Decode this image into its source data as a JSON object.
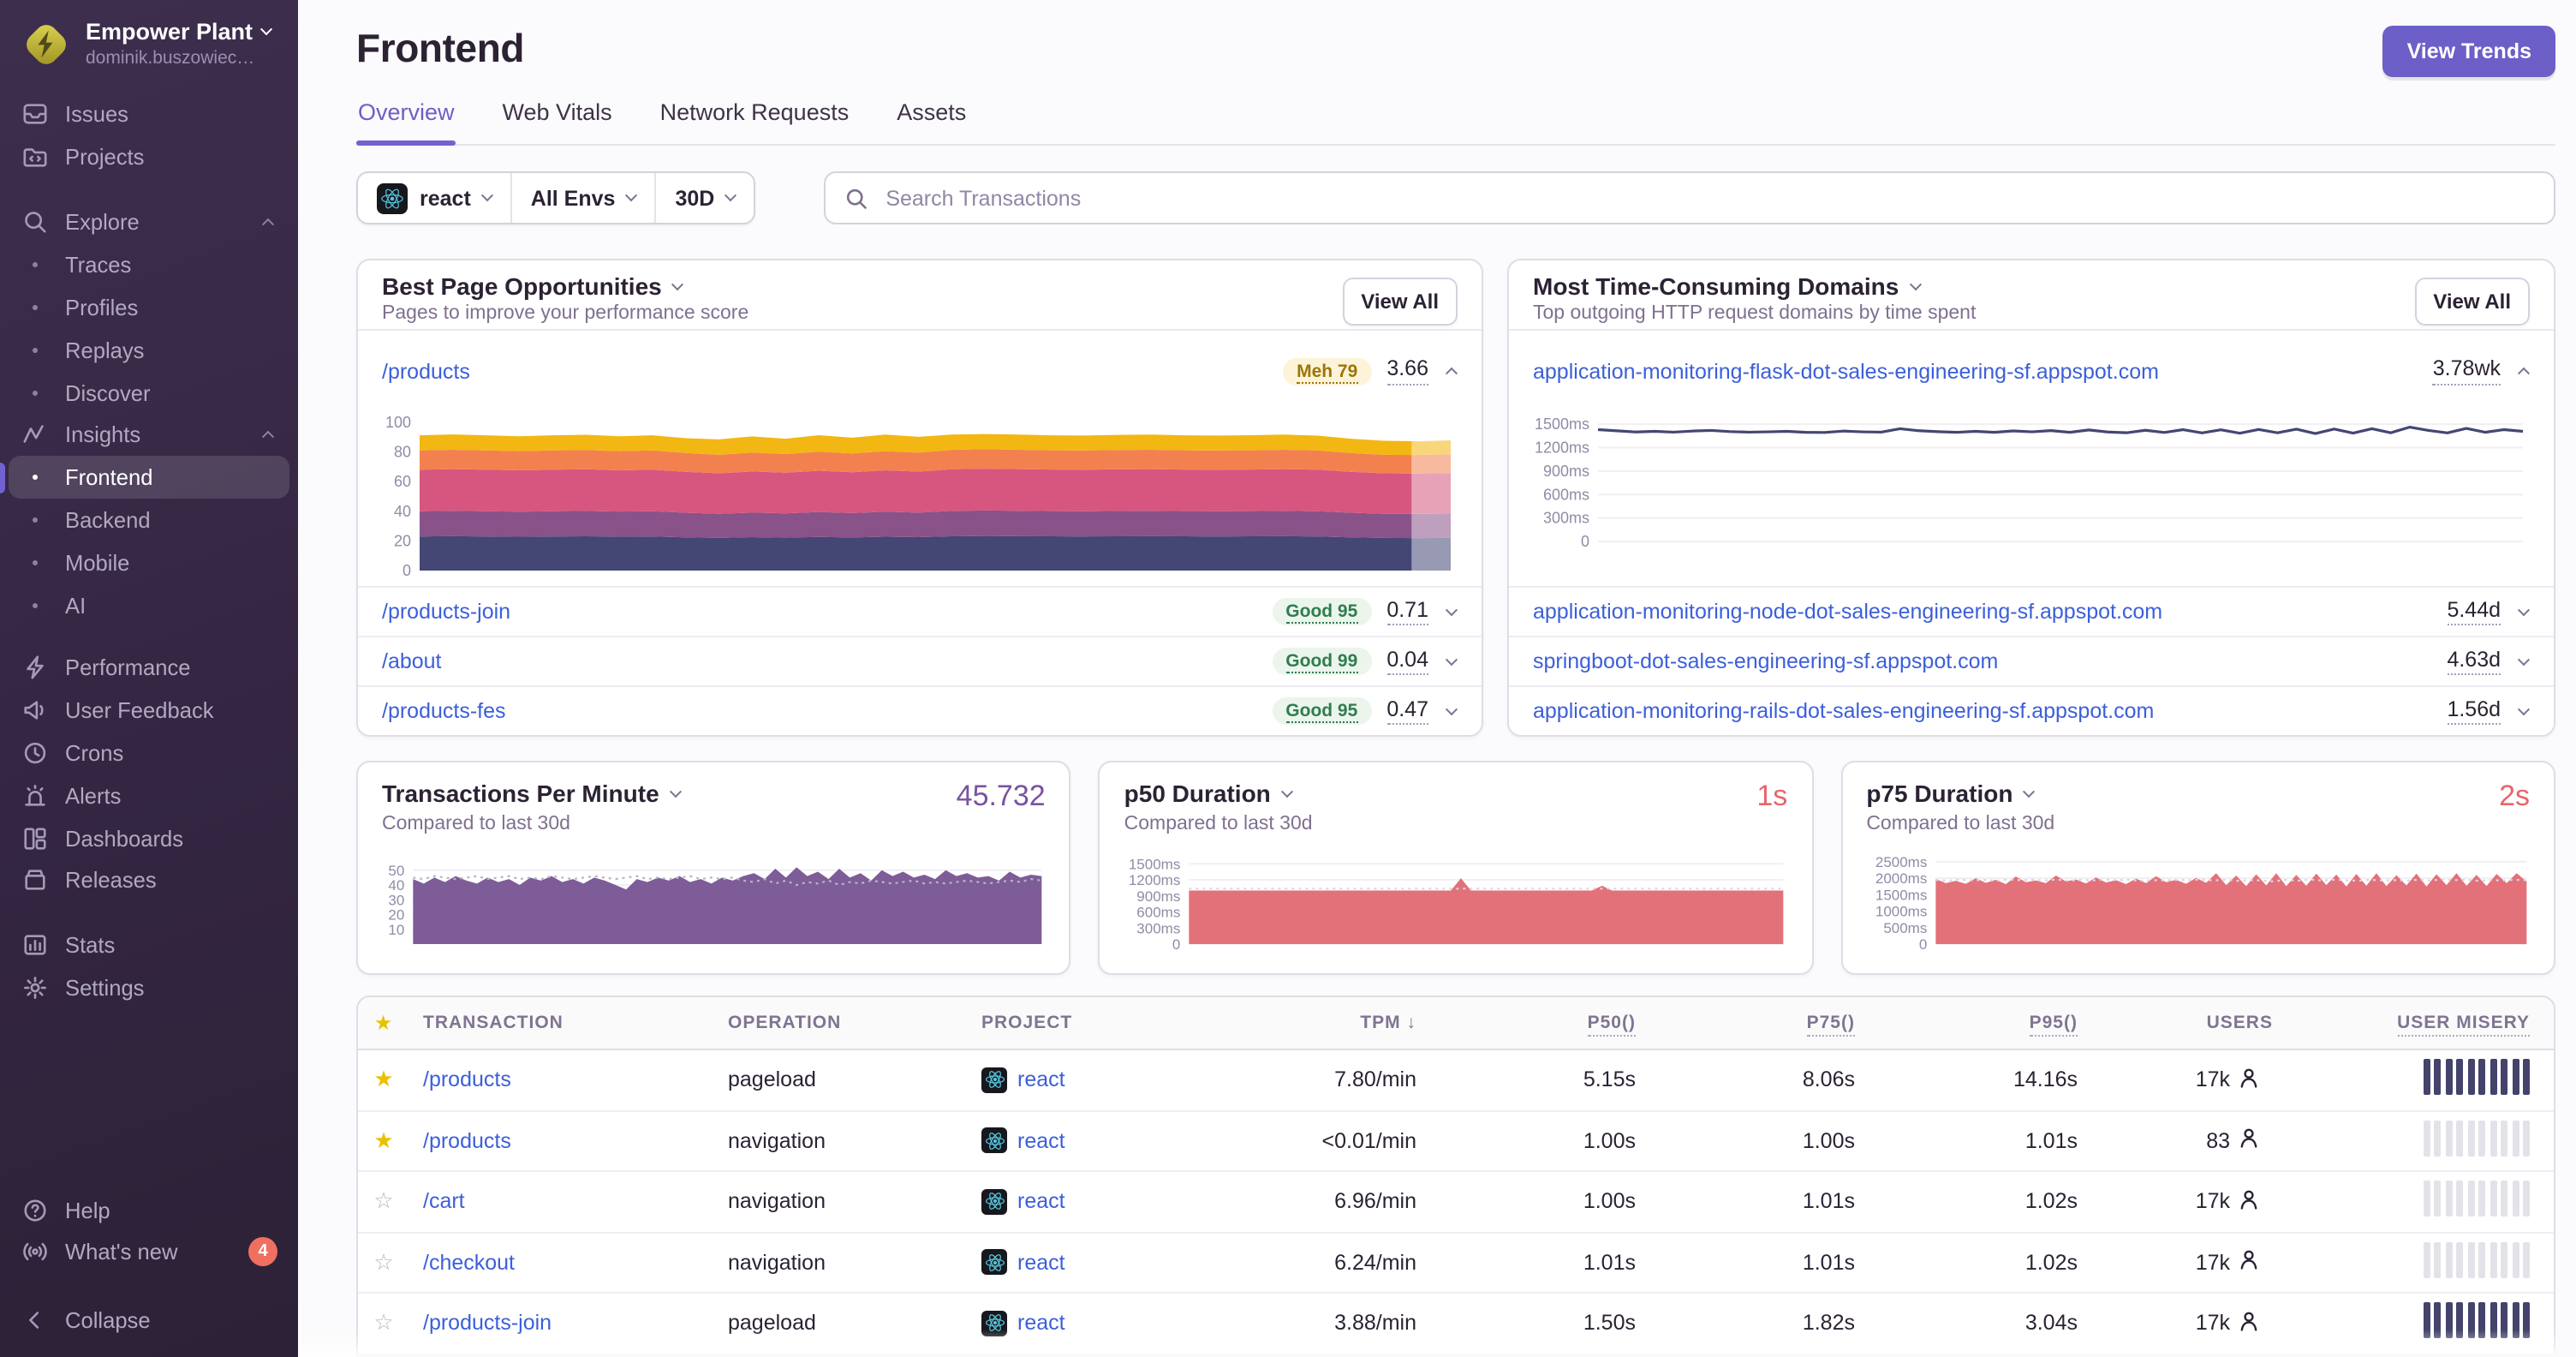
{
  "colors": {
    "accent": "#6C5FC7",
    "link": "#3c5fd9",
    "value_purple": "#7a52a0",
    "value_red": "#e7656d",
    "misery_high": "#43436b",
    "misery_low": "#e4e2e9",
    "badge_meh_bg": "#fdf3d8",
    "badge_meh_text": "#9c7507",
    "badge_good_bg": "#ebf5ec",
    "badge_good_text": "#2f7d4f",
    "whats_new_badge": "#ef7061",
    "sidebar_accent": "#7262d1"
  },
  "sidebar": {
    "org_name": "Empower Plant",
    "org_user": "dominik.buszowiec…",
    "sections": [
      {
        "gap": "",
        "items": [
          {
            "label": "Issues",
            "icon": "issues-icon"
          },
          {
            "label": "Projects",
            "icon": "projects-icon"
          }
        ]
      },
      {
        "gap": "sec-gap1",
        "items": [
          {
            "label": "Explore",
            "icon": "search-icon",
            "chevron": "up"
          },
          {
            "label": "Traces",
            "bullet": true
          },
          {
            "label": "Profiles",
            "bullet": true
          },
          {
            "label": "Replays",
            "bullet": true
          },
          {
            "label": "Discover",
            "bullet": true
          },
          {
            "label": "Insights",
            "icon": "insights-icon",
            "chevron": "up"
          },
          {
            "label": "Frontend",
            "bullet": true,
            "active": true
          },
          {
            "label": "Backend",
            "bullet": true
          },
          {
            "label": "Mobile",
            "bullet": true
          },
          {
            "label": "AI",
            "bullet": true
          }
        ]
      },
      {
        "gap": "sec-gap2",
        "items": [
          {
            "label": "Performance",
            "icon": "performance-icon"
          },
          {
            "label": "User Feedback",
            "icon": "megaphone-icon"
          },
          {
            "label": "Crons",
            "icon": "clock-icon"
          },
          {
            "label": "Alerts",
            "icon": "siren-icon"
          },
          {
            "label": "Dashboards",
            "icon": "dashboards-icon"
          },
          {
            "label": "Releases",
            "icon": "releases-icon"
          }
        ]
      },
      {
        "gap": "sec-gap3",
        "items": [
          {
            "label": "Stats",
            "icon": "stats-icon"
          },
          {
            "label": "Settings",
            "icon": "gear-icon"
          }
        ]
      }
    ],
    "footer": [
      {
        "label": "Help",
        "icon": "help-icon"
      },
      {
        "label": "What's new",
        "icon": "broadcast-icon",
        "badge": "4"
      },
      {
        "label": "Collapse",
        "icon": "chevron-left-icon",
        "gap": true
      }
    ]
  },
  "header": {
    "title": "Frontend",
    "view_trends_label": "View Trends",
    "tabs": [
      {
        "label": "Overview",
        "active": true
      },
      {
        "label": "Web Vitals"
      },
      {
        "label": "Network Requests"
      },
      {
        "label": "Assets"
      }
    ]
  },
  "filters": {
    "project": "react",
    "environment": "All Envs",
    "date_range": "30D",
    "search_placeholder": "Search Transactions"
  },
  "best_pages": {
    "title": "Best Page Opportunities",
    "subtitle": "Pages to improve your performance score",
    "view_all_label": "View All",
    "expanded_row": {
      "page": "/products",
      "badge_label": "Meh 79",
      "badge_type": "meh",
      "score": "3.66"
    },
    "rows": [
      {
        "page": "/products-join",
        "badge_label": "Good 95",
        "badge_type": "good",
        "score": "0.71"
      },
      {
        "page": "/about",
        "badge_label": "Good 99",
        "badge_type": "good",
        "score": "0.04"
      },
      {
        "page": "/products-fes",
        "badge_label": "Good 95",
        "badge_type": "good",
        "score": "0.47"
      }
    ]
  },
  "domains": {
    "title": "Most Time-Consuming Domains",
    "subtitle": "Top outgoing HTTP request domains by time spent",
    "view_all_label": "View All",
    "expanded_row": {
      "domain": "application-monitoring-flask-dot-sales-engineering-sf.appspot.com",
      "value": "3.78wk"
    },
    "rows": [
      {
        "domain": "application-monitoring-node-dot-sales-engineering-sf.appspot.com",
        "value": "5.44d"
      },
      {
        "domain": "springboot-dot-sales-engineering-sf.appspot.com",
        "value": "4.63d"
      },
      {
        "domain": "application-monitoring-rails-dot-sales-engineering-sf.appspot.com",
        "value": "1.56d"
      }
    ]
  },
  "metrics": [
    {
      "id": "tpm",
      "title": "Transactions Per Minute",
      "subtitle": "Compared to last 30d",
      "value": "45.732",
      "value_color": "#7a52a0"
    },
    {
      "id": "p50",
      "title": "p50 Duration",
      "subtitle": "Compared to last 30d",
      "value": "1s",
      "value_color": "#e7656d"
    },
    {
      "id": "p75",
      "title": "p75 Duration",
      "subtitle": "Compared to last 30d",
      "value": "2s",
      "value_color": "#e7656d"
    }
  ],
  "table": {
    "sorted_column": "TPM",
    "sort_direction": "desc",
    "sort_arrow": "↓",
    "columns": [
      "TRANSACTION",
      "OPERATION",
      "PROJECT",
      "TPM",
      "P50()",
      "P75()",
      "P95()",
      "USERS",
      "USER MISERY"
    ],
    "rows": [
      {
        "starred": true,
        "transaction": "/products",
        "operation": "pageload",
        "project": "react",
        "tpm": "7.80/min",
        "p50": "5.15s",
        "p75": "8.06s",
        "p95": "14.16s",
        "users": "17k",
        "misery": "high"
      },
      {
        "starred": true,
        "transaction": "/products",
        "operation": "navigation",
        "project": "react",
        "tpm": "<0.01/min",
        "p50": "1.00s",
        "p75": "1.00s",
        "p95": "1.01s",
        "users": "83",
        "misery": "low"
      },
      {
        "starred": false,
        "transaction": "/cart",
        "operation": "navigation",
        "project": "react",
        "tpm": "6.96/min",
        "p50": "1.00s",
        "p75": "1.01s",
        "p95": "1.02s",
        "users": "17k",
        "misery": "low"
      },
      {
        "starred": false,
        "transaction": "/checkout",
        "operation": "navigation",
        "project": "react",
        "tpm": "6.24/min",
        "p50": "1.01s",
        "p75": "1.01s",
        "p95": "1.02s",
        "users": "17k",
        "misery": "low"
      },
      {
        "starred": false,
        "transaction": "/products-join",
        "operation": "pageload",
        "project": "react",
        "tpm": "3.88/min",
        "p50": "1.50s",
        "p75": "1.82s",
        "p95": "3.04s",
        "users": "17k",
        "misery": "high"
      }
    ]
  },
  "chart_data": [
    {
      "id": "page_score_breakdown",
      "type": "stacked_area",
      "title": "/products performance score breakdown",
      "grid": false,
      "ylim": [
        0,
        104
      ],
      "label_width": 30,
      "tick_font": 9,
      "incomplete_from": 0.962,
      "yticks": [
        [
          100,
          "100"
        ],
        [
          80,
          "80"
        ],
        [
          60,
          "60"
        ],
        [
          40,
          "40"
        ],
        [
          20,
          "20"
        ],
        [
          0,
          "0"
        ]
      ],
      "series": [
        {
          "name": "layer-1",
          "color": "#444674",
          "values": [
            23,
            23.2,
            23,
            22.8,
            23,
            23.1,
            22.9,
            23,
            22.4,
            22,
            22.5,
            22.2,
            22.7,
            22.3,
            22.8,
            22.5,
            23.1,
            23.3,
            23.2,
            23.1,
            23,
            23.1,
            23.2,
            23.1,
            23,
            23.1,
            23.2,
            23,
            22.4,
            22,
            21.9,
            22
          ]
        },
        {
          "name": "layer-2",
          "color": "#895289",
          "values": [
            17,
            17.1,
            17,
            16.9,
            17,
            17.1,
            16.9,
            17,
            16.6,
            16.3,
            16.6,
            16.4,
            16.8,
            16.5,
            16.9,
            16.6,
            17.1,
            17.2,
            17.1,
            17,
            17,
            17.1,
            17.1,
            17,
            17,
            17,
            17.1,
            17,
            16.6,
            16.3,
            16.3,
            16.4
          ]
        },
        {
          "name": "layer-3",
          "color": "#d6567f",
          "values": [
            28,
            28.1,
            28,
            27.9,
            28,
            28.1,
            27.8,
            28,
            27.6,
            27.3,
            27.7,
            27.4,
            27.8,
            27.5,
            27.9,
            27.6,
            28.1,
            28.2,
            28.1,
            28,
            28,
            28.1,
            28.1,
            28,
            28,
            28,
            28.1,
            28,
            27.6,
            27.3,
            27.2,
            27.4
          ]
        },
        {
          "name": "layer-4",
          "color": "#f38150",
          "values": [
            13,
            13.1,
            13,
            12.9,
            13,
            13,
            12.9,
            13,
            12.7,
            12.5,
            12.8,
            12.6,
            12.9,
            12.7,
            12.9,
            12.8,
            13.1,
            13.2,
            13.1,
            13,
            13,
            13,
            13.1,
            13,
            13,
            13,
            13.1,
            13,
            12.7,
            12.5,
            12.5,
            12.6
          ]
        },
        {
          "name": "layer-5",
          "color": "#f2b712",
          "values": [
            10.2,
            10.3,
            10.2,
            10.1,
            10.2,
            10.3,
            10.1,
            10.2,
            10,
            10.4,
            10.9,
            10.3,
            11.1,
            10.6,
            11.2,
            10.7,
            10.3,
            10.2,
            10.2,
            10.1,
            10.1,
            10.2,
            10.2,
            10.1,
            10.1,
            10.2,
            10.2,
            10,
            9.6,
            9.4,
            9.3,
            9.4
          ]
        }
      ]
    },
    {
      "id": "domain_time",
      "type": "line",
      "title": "flask domain avg duration",
      "color": "#444674",
      "ylim": [
        0,
        1600
      ],
      "label_width": 46,
      "bottom_pad": 26,
      "tick_font": 9,
      "yticks": [
        [
          1500,
          "1500ms"
        ],
        [
          1200,
          "1200ms"
        ],
        [
          900,
          "900ms"
        ],
        [
          600,
          "600ms"
        ],
        [
          300,
          "300ms"
        ],
        [
          0,
          "0"
        ]
      ],
      "values": [
        1430,
        1415,
        1400,
        1408,
        1398,
        1412,
        1420,
        1405,
        1398,
        1402,
        1408,
        1396,
        1394,
        1412,
        1402,
        1398,
        1442,
        1416,
        1404,
        1396,
        1408,
        1396,
        1414,
        1402,
        1418,
        1396,
        1426,
        1400,
        1390,
        1422,
        1394,
        1430,
        1388,
        1428,
        1384,
        1432,
        1390,
        1436,
        1380,
        1438,
        1386,
        1442,
        1390,
        1462,
        1420,
        1388,
        1446,
        1396,
        1430,
        1408
      ]
    },
    {
      "id": "tpm",
      "type": "area",
      "title": "Transactions Per Minute",
      "color": "#7d5c97",
      "prev_color": "#b9b3c6",
      "ylim": [
        0,
        58
      ],
      "label_width": 24,
      "tick_font": 8.5,
      "yticks": [
        [
          50,
          "50"
        ],
        [
          40,
          "40"
        ],
        [
          30,
          "30"
        ],
        [
          20,
          "20"
        ],
        [
          10,
          "10"
        ]
      ],
      "values": [
        44,
        41,
        45,
        42,
        46,
        43,
        41,
        45,
        42,
        44,
        40,
        45,
        43,
        46,
        42,
        44,
        41,
        45,
        43,
        40,
        37,
        44,
        42,
        45,
        43,
        46,
        42,
        44,
        41,
        45,
        43,
        46,
        48,
        44,
        51,
        45,
        52,
        46,
        49,
        44,
        51,
        45,
        48,
        43,
        50,
        46,
        49,
        45,
        47,
        44,
        50,
        46,
        48,
        45,
        46,
        43,
        49,
        45,
        47,
        46
      ],
      "prev": [
        45,
        44,
        46,
        45,
        44,
        45,
        46,
        44,
        45,
        46,
        44,
        45,
        44,
        46,
        45,
        44,
        45,
        46,
        45,
        44,
        45,
        46,
        44,
        45,
        44,
        45,
        46,
        44,
        45,
        44,
        45,
        43,
        42,
        44,
        41,
        43,
        40,
        42,
        41,
        43,
        40,
        42,
        41,
        43,
        42,
        41,
        42,
        43,
        41,
        42,
        41,
        42,
        43,
        42,
        41,
        42,
        43,
        42,
        44,
        43
      ]
    },
    {
      "id": "p50",
      "type": "area",
      "title": "p50 Duration",
      "color": "#e2717a",
      "prev_color": "#ddd5e2",
      "ylim": [
        0,
        1600
      ],
      "label_width": 44,
      "tick_font": 8.5,
      "yticks": [
        [
          1500,
          "1500ms"
        ],
        [
          1200,
          "1200ms"
        ],
        [
          900,
          "900ms"
        ],
        [
          600,
          "600ms"
        ],
        [
          300,
          "300ms"
        ],
        [
          0,
          "0"
        ]
      ],
      "values": [
        1000,
        1000,
        1000,
        1000,
        1000,
        1000,
        1000,
        1000,
        1000,
        1000,
        1000,
        1000,
        1000,
        1000,
        1000,
        1000,
        1000,
        1000,
        1000,
        1000,
        1000,
        1000,
        1000,
        1000,
        1000,
        1000,
        1000,
        1230,
        1000,
        1000,
        1000,
        1000,
        1000,
        1000,
        1000,
        1000,
        1000,
        1000,
        1000,
        1000,
        1000,
        1090,
        1000,
        1000,
        1000,
        1000,
        1000,
        1000,
        1000,
        1000,
        1000,
        1000,
        1000,
        1000,
        1000,
        1000,
        1000,
        1000,
        1000,
        1000
      ],
      "prev": [
        1035,
        1035
      ]
    },
    {
      "id": "p75",
      "type": "area",
      "title": "p75 Duration",
      "color": "#e2717a",
      "prev_color": "#ddd5e2",
      "ylim": [
        0,
        2600
      ],
      "label_width": 46,
      "tick_font": 8.5,
      "yticks": [
        [
          2500,
          "2500ms"
        ],
        [
          2000,
          "2000ms"
        ],
        [
          1500,
          "1500ms"
        ],
        [
          1000,
          "1000ms"
        ],
        [
          500,
          "500ms"
        ],
        [
          0,
          "0"
        ]
      ],
      "values": [
        1980,
        1850,
        1920,
        1830,
        2000,
        1860,
        1950,
        1820,
        2050,
        1880,
        1930,
        1850,
        2080,
        1900,
        1960,
        1840,
        2020,
        1870,
        1940,
        1820,
        1990,
        1850,
        2060,
        1880,
        1950,
        1830,
        2010,
        1860,
        2150,
        1790,
        2080,
        1760,
        2120,
        1780,
        2150,
        1760,
        2100,
        1770,
        2140,
        1790,
        2110,
        1750,
        2130,
        1770,
        2150,
        1760,
        2090,
        1780,
        2140,
        1750,
        2120,
        1790,
        2150,
        1770,
        2100,
        1760,
        2130,
        1850,
        2150,
        1900
      ],
      "prev": [
        1950,
        1920,
        1960,
        1930,
        1950,
        1920,
        1960,
        1940,
        1950,
        1930,
        1960,
        1920,
        1950,
        1930,
        1960,
        1940,
        1950,
        1920,
        1940,
        1930,
        1950,
        1940,
        1960,
        1930,
        1950,
        1920,
        1940,
        1930,
        1900,
        1950,
        1920,
        1960,
        1930,
        1950,
        1940,
        1920,
        1950,
        1930,
        1940,
        1920,
        1950,
        1930,
        1960,
        1940,
        1950,
        1920,
        1940,
        1930,
        1950,
        1940
      ]
    }
  ]
}
